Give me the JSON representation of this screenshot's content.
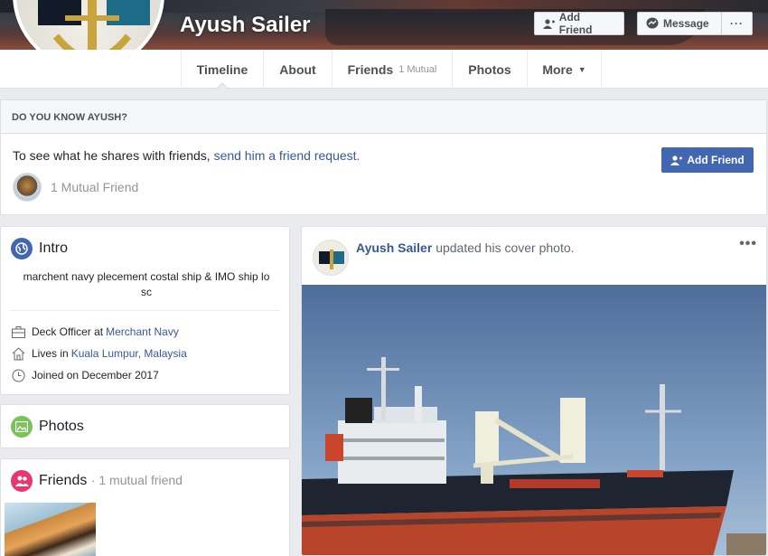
{
  "profile": {
    "name": "Ayush Sailer"
  },
  "cover_actions": {
    "add_friend": "Add Friend",
    "message": "Message",
    "more": "···"
  },
  "nav": {
    "tabs": [
      {
        "label": "Timeline",
        "active": true
      },
      {
        "label": "About"
      },
      {
        "label": "Friends",
        "sub": "1 Mutual"
      },
      {
        "label": "Photos"
      },
      {
        "label": "More"
      }
    ]
  },
  "know_box": {
    "heading": "DO YOU KNOW AYUSH?",
    "text_prefix": "To see what he shares with friends,",
    "link_text": "send him a friend request.",
    "mutual": "1 Mutual Friend",
    "button": "Add Friend"
  },
  "intro": {
    "title": "Intro",
    "bio_line1": "marchent navy plecement costal ship & IMO ship lo",
    "bio_line2": "sc",
    "work_prefix": "Deck Officer at",
    "work_link": "Merchant Navy",
    "lives_prefix": "Lives in",
    "lives_link": "Kuala Lumpur, Malaysia",
    "joined": "Joined on December 2017"
  },
  "photos": {
    "title": "Photos"
  },
  "friends": {
    "title": "Friends",
    "count": "· 1 mutual friend"
  },
  "post": {
    "author": "Ayush Sailer",
    "action": "updated his cover photo.",
    "more": "•••"
  },
  "colors": {
    "link": "#365899",
    "primary_button": "#4267b2",
    "intro_icon": "#4267b2",
    "photos_icon": "#7ac35b",
    "friends_icon": "#e8376e"
  },
  "icons": [
    "add-friend-icon",
    "messenger-icon",
    "globe-icon",
    "briefcase-icon",
    "home-icon",
    "clock-icon",
    "photo-icon",
    "friends-icon",
    "caret-down-icon"
  ]
}
